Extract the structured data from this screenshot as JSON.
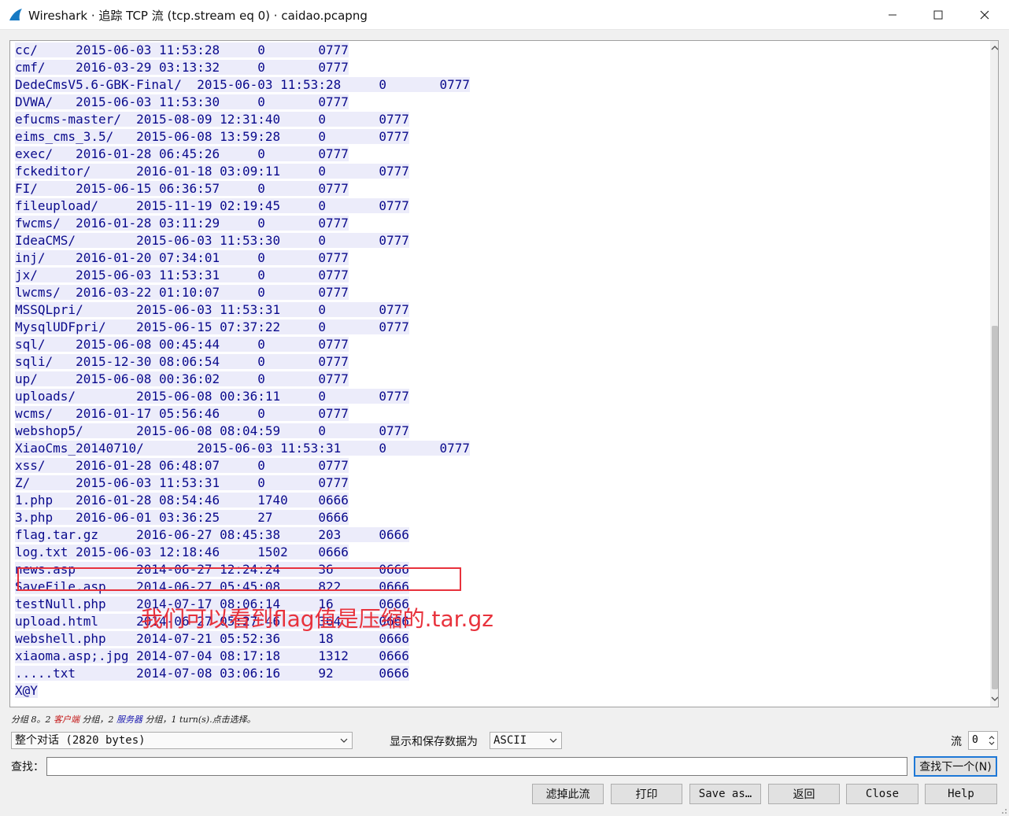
{
  "window": {
    "title": "Wireshark · 追踪 TCP 流 (tcp.stream eq 0) · caidao.pcapng",
    "accent": "#1e78d7"
  },
  "stream": {
    "lines": [
      "cc/\t2015-06-03 11:53:28\t0\t0777",
      "cmf/\t2016-03-29 03:13:32\t0\t0777",
      "DedeCmsV5.6-GBK-Final/\t2015-06-03 11:53:28\t0\t0777",
      "DVWA/\t2015-06-03 11:53:30\t0\t0777",
      "efucms-master/\t2015-08-09 12:31:40\t0\t0777",
      "eims_cms_3.5/\t2015-06-08 13:59:28\t0\t0777",
      "exec/\t2016-01-28 06:45:26\t0\t0777",
      "fckeditor/\t2016-01-18 03:09:11\t0\t0777",
      "FI/\t2015-06-15 06:36:57\t0\t0777",
      "fileupload/\t2015-11-19 02:19:45\t0\t0777",
      "fwcms/\t2016-01-28 03:11:29\t0\t0777",
      "IdeaCMS/\t2015-06-03 11:53:30\t0\t0777",
      "inj/\t2016-01-20 07:34:01\t0\t0777",
      "jx/\t2015-06-03 11:53:31\t0\t0777",
      "lwcms/\t2016-03-22 01:10:07\t0\t0777",
      "MSSQLpri/\t2015-06-03 11:53:31\t0\t0777",
      "MysqlUDFpri/\t2015-06-15 07:37:22\t0\t0777",
      "sql/\t2015-06-08 00:45:44\t0\t0777",
      "sqli/\t2015-12-30 08:06:54\t0\t0777",
      "up/\t2015-06-08 00:36:02\t0\t0777",
      "uploads/\t2015-06-08 00:36:11\t0\t0777",
      "wcms/\t2016-01-17 05:56:46\t0\t0777",
      "webshop5/\t2015-06-08 08:04:59\t0\t0777",
      "XiaoCms_20140710/\t2015-06-03 11:53:31\t0\t0777",
      "xss/\t2016-01-28 06:48:07\t0\t0777",
      "Z/\t2015-06-03 11:53:31\t0\t0777",
      "1.php\t2016-01-28 08:54:46\t1740\t0666",
      "3.php\t2016-06-01 03:36:25\t27\t0666",
      "flag.tar.gz\t2016-06-27 08:45:38\t203\t0666",
      "log.txt\t2015-06-03 12:18:46\t1502\t0666",
      "news.asp\t2014-06-27 12:24:24\t36\t0666",
      "SaveFile.asp\t2014-06-27 05:45:08\t822\t0666",
      "testNull.php\t2014-07-17 08:06:14\t16\t0666",
      "upload.html\t2014-06-27 05:27:46\t364\t0666",
      "webshell.php\t2014-07-21 05:52:36\t18\t0666",
      "xiaoma.asp;.jpg\t2014-07-04 08:17:18\t1312\t0666",
      ".....txt\t2014-07-08 03:06:16\t92\t0666",
      "X@Y"
    ],
    "client_color": "#0a0a8c",
    "client_bg": "#ececfa"
  },
  "annotation": {
    "text": "我们可以看到flag值是压缩的.tar.gz",
    "color": "#e8323c"
  },
  "status": {
    "prefix": "分组 8。2 ",
    "client": "客户端",
    "middle": " 分组，2 ",
    "server": "服务器",
    "suffix": " 分组，1 turn(s).点击选择。"
  },
  "controls": {
    "conversation": "整个对话 (2820 bytes)",
    "format_label": "显示和保存数据为",
    "format_value": "ASCII",
    "stream_label": "流",
    "stream_value": "0",
    "find_label": "查找：",
    "find_value": "",
    "find_next": "查找下一个(N)"
  },
  "buttons": {
    "filter_out": "滤掉此流",
    "print": "打印",
    "save_as": "Save as…",
    "back": "返回",
    "close": "Close",
    "help": "Help"
  }
}
